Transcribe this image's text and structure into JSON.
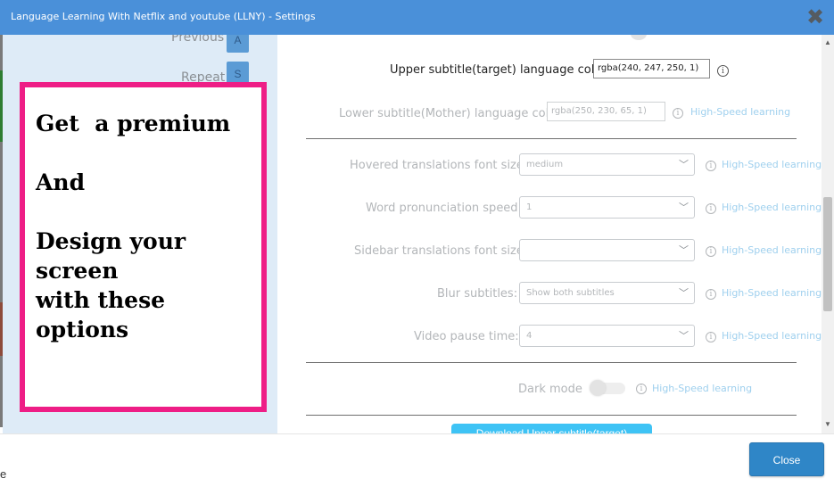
{
  "window": {
    "title": "Language Learning With Netflix and youtube (LLNY) - Settings"
  },
  "sidebar": {
    "shortcuts": [
      {
        "label": "Previous",
        "key": "A"
      },
      {
        "label": "Repeat",
        "key": "S"
      }
    ]
  },
  "promo": {
    "text": "Get  a premium\n\nAnd\n\nDesign your\nscreen\nwith these\noptions"
  },
  "settings": {
    "upper_color": {
      "label": "Upper subtitle(target) language color",
      "value": "rgba(240, 247, 250, 1)"
    },
    "lower_color": {
      "label": "Lower subtitle(Mother) language color",
      "value": "rgba(250, 230, 65, 1)",
      "badge": "High-Speed learning"
    },
    "hover_font": {
      "label": "Hovered translations font size:",
      "value": "medium",
      "badge": "High-Speed learning"
    },
    "pron_speed": {
      "label": "Word pronunciation speed:",
      "value": "1",
      "badge": "High-Speed learning"
    },
    "sidebar_font": {
      "label": "Sidebar translations font size:",
      "value": "",
      "badge": "High-Speed learning"
    },
    "blur": {
      "label": "Blur subtitles:",
      "value": "Show both subtitles",
      "badge": "High-Speed learning"
    },
    "pause": {
      "label": "Video pause time:",
      "value": "4",
      "badge": "High-Speed learning"
    },
    "dark_mode": {
      "label": "Dark mode",
      "on": false,
      "badge": "High-Speed learning"
    },
    "download_label": "Download Upper subtitle(target)"
  },
  "footer": {
    "fragment": "e",
    "close_label": "Close"
  },
  "colors": {
    "title_bar": "#4a90d9",
    "sidebar_bg": "#deebf7",
    "promo_border": "#ee1e86",
    "accent_link": "#9fd0ee",
    "close_button": "#2f86c7"
  }
}
